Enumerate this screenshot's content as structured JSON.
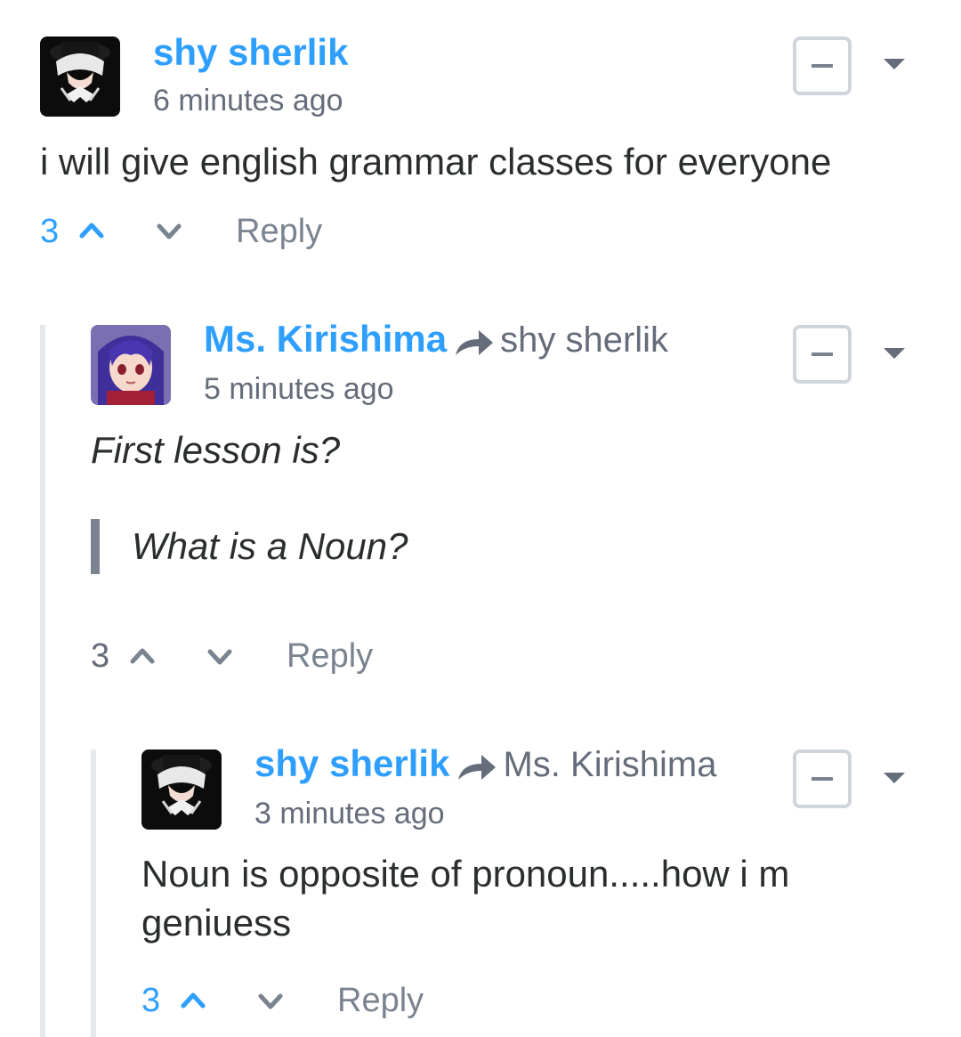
{
  "comments": [
    {
      "author": "shy sherlik",
      "reply_to": "",
      "time": "6 minutes ago",
      "message": "i will give english grammar classes for everyone",
      "votes": "3",
      "reply_label": "Reply",
      "avatar_icon": "dark-hat-anime-avatar"
    },
    {
      "author": "Ms. Kirishima",
      "reply_to": "shy sherlik",
      "time": "5 minutes ago",
      "message": "First lesson is?",
      "quote": "What is a Noun?",
      "votes": "3",
      "reply_label": "Reply",
      "avatar_icon": "purple-hair-anime-girl-avatar"
    },
    {
      "author": "shy sherlik",
      "reply_to": "Ms. Kirishima",
      "time": "3 minutes ago",
      "message_line1": "Noun is opposite of pronoun.....how i m",
      "message_line2": "geniuess",
      "votes": "3",
      "reply_label": "Reply",
      "avatar_icon": "dark-hat-anime-avatar"
    }
  ],
  "colors": {
    "author": "#2e9fff",
    "muted": "#656c7a",
    "thread_line": "#e6e9ec"
  }
}
